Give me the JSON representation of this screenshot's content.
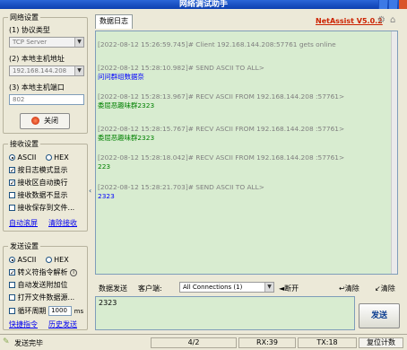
{
  "window": {
    "title": "网络调试助手"
  },
  "brand": {
    "name": "NetAssist V5.0.2"
  },
  "net_settings": {
    "group_label": "网络设置",
    "protocol_label": "(1) 协议类型",
    "protocol_value": "TCP Server",
    "host_label": "(2) 本地主机地址",
    "host_value": "192.168.144.208",
    "port_label": "(3) 本地主机端口",
    "port_value": "802",
    "close_button": "关闭"
  },
  "recv_settings": {
    "group_label": "接收设置",
    "ascii": "ASCII",
    "hex": "HEX",
    "options": [
      {
        "label": "按日志模式显示",
        "checked": true
      },
      {
        "label": "接收区自动换行",
        "checked": true
      },
      {
        "label": "接收数据不显示",
        "checked": false
      },
      {
        "label": "接收保存到文件...",
        "checked": false
      }
    ],
    "auto_scroll": "自动滚屏",
    "clear_recv": "清除接收"
  },
  "send_settings": {
    "group_label": "发送设置",
    "ascii": "ASCII",
    "hex": "HEX",
    "options": [
      {
        "label": "转义符指令解析",
        "checked": true
      },
      {
        "label": "自动发送附加位",
        "checked": false
      },
      {
        "label": "打开文件数据源...",
        "checked": false
      }
    ],
    "loop_label": "循环周期",
    "loop_value": "1000",
    "loop_unit": "ms",
    "quick_cmd": "快捷指令",
    "history": "历史发送"
  },
  "tabs": {
    "log": "数据日志"
  },
  "log_entries": [
    {
      "header": "[2022-08-12 15:26:59.745]# Client 192.168.144.208:57761 gets online",
      "message": ""
    },
    {
      "header": "[2022-08-12 15:28:10.982]# SEND ASCII TO ALL>",
      "message": "问问群组数据奈",
      "kind": "send"
    },
    {
      "header": "[2022-08-12 15:28:13.967]# RECV ASCII FROM 192.168.144.208 :57761>",
      "message": "委屈恶趣味群2323",
      "kind": "recv"
    },
    {
      "header": "[2022-08-12 15:28:15.767]# RECV ASCII FROM 192.168.144.208 :57761>",
      "message": "委屈恶趣味群2323",
      "kind": "recv"
    },
    {
      "header": "[2022-08-12 15:28:18.042]# RECV ASCII FROM 192.168.144.208 :57761>",
      "message": "223",
      "kind": "recv"
    },
    {
      "header": "[2022-08-12 15:28:21.703]# SEND ASCII TO ALL>",
      "message": "2323",
      "kind": "send"
    }
  ],
  "send_bar": {
    "data_send": "数据发送",
    "client_label": "客户端:",
    "client_select": "All Connections (1)",
    "disconnect": "断开",
    "clear1": "清除",
    "clear2": "清除",
    "input_value": "2323",
    "send_button": "发送"
  },
  "status": {
    "ready": "发送完毕",
    "count": "4/2",
    "rx": "RX:39",
    "tx": "TX:18",
    "reset": "复位计数"
  },
  "colors": {
    "log_bg": "#d8ecd0",
    "brand": "#cc2200",
    "link": "#0000ee"
  }
}
